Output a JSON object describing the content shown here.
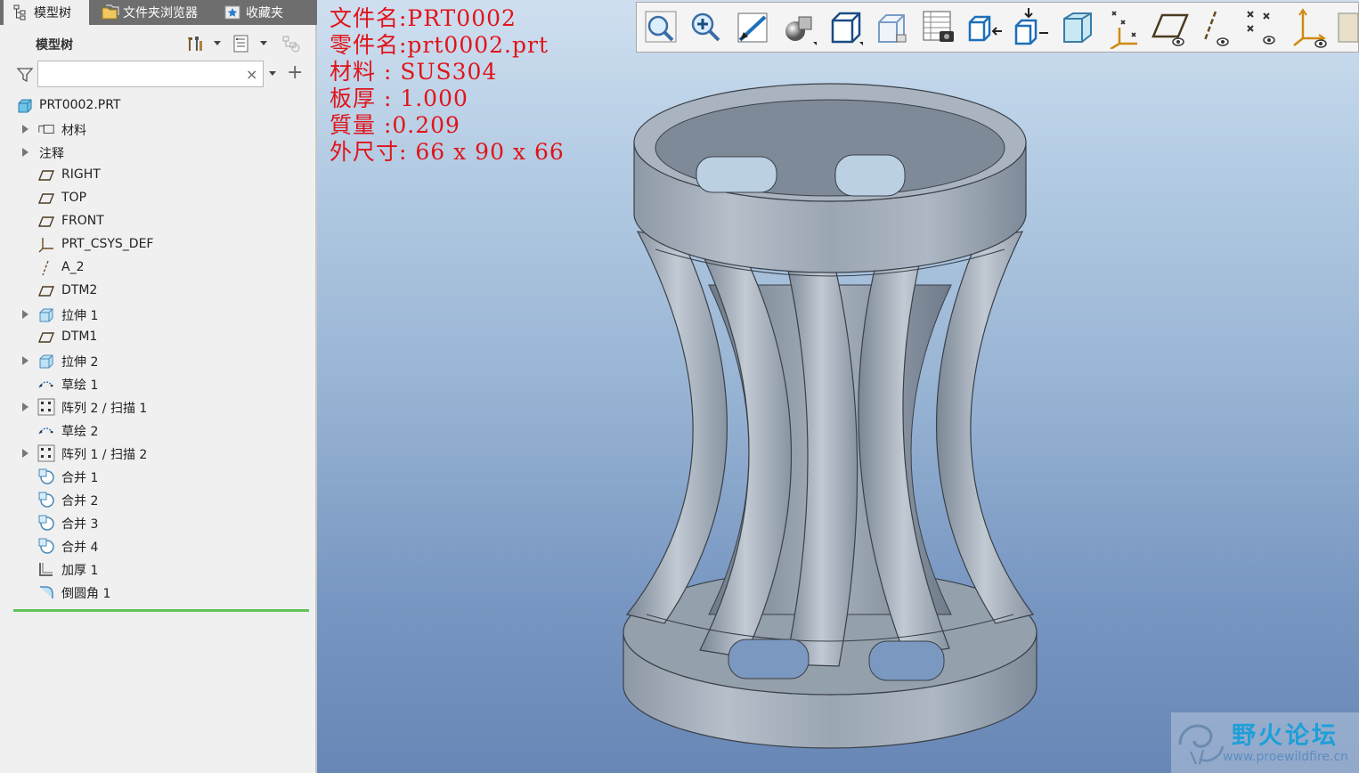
{
  "tabs": [
    {
      "label": "模型树",
      "icon": "model-tree-icon"
    },
    {
      "label": "文件夹浏览器",
      "icon": "folder-browser-icon"
    },
    {
      "label": "收藏夹",
      "icon": "favorites-icon"
    }
  ],
  "tree_header": {
    "label": "模型树"
  },
  "search": {
    "value": "",
    "placeholder": "",
    "clear_glyph": "×"
  },
  "add_glyph": "+",
  "tree": {
    "items": [
      {
        "label": "PRT0002.PRT",
        "icon": "part-icon",
        "expandable": false
      },
      {
        "label": "材料",
        "icon": "material-icon",
        "expandable": true
      },
      {
        "label": "注释",
        "icon": "",
        "expandable": true
      },
      {
        "label": "RIGHT",
        "icon": "datum-plane-icon",
        "expandable": false
      },
      {
        "label": "TOP",
        "icon": "datum-plane-icon",
        "expandable": false
      },
      {
        "label": "FRONT",
        "icon": "datum-plane-icon",
        "expandable": false
      },
      {
        "label": "PRT_CSYS_DEF",
        "icon": "csys-icon",
        "expandable": false
      },
      {
        "label": "A_2",
        "icon": "datum-axis-icon",
        "expandable": false
      },
      {
        "label": "DTM2",
        "icon": "datum-plane-icon",
        "expandable": false
      },
      {
        "label": "拉伸 1",
        "icon": "extrude-icon",
        "expandable": true
      },
      {
        "label": "DTM1",
        "icon": "datum-plane-icon",
        "expandable": false
      },
      {
        "label": "拉伸 2",
        "icon": "extrude-icon",
        "expandable": true
      },
      {
        "label": "草绘 1",
        "icon": "sketch-icon",
        "expandable": false
      },
      {
        "label": "阵列 2 / 扫描 1",
        "icon": "pattern-icon",
        "expandable": true
      },
      {
        "label": "草绘 2",
        "icon": "sketch-icon",
        "expandable": false
      },
      {
        "label": "阵列 1 / 扫描 2",
        "icon": "pattern-icon",
        "expandable": true
      },
      {
        "label": "合并 1",
        "icon": "merge-icon",
        "expandable": false
      },
      {
        "label": "合并 2",
        "icon": "merge-icon",
        "expandable": false
      },
      {
        "label": "合并 3",
        "icon": "merge-icon",
        "expandable": false
      },
      {
        "label": "合并 4",
        "icon": "merge-icon",
        "expandable": false
      },
      {
        "label": "加厚 1",
        "icon": "thicken-icon",
        "expandable": false
      },
      {
        "label": "倒圆角 1",
        "icon": "round-icon",
        "expandable": false
      }
    ]
  },
  "info": {
    "lines": [
      "文件名:PRT0002",
      "零件名:prt0002.prt",
      "材料 : SUS304",
      "板厚 : 1.000",
      "質量 :0.209",
      "外尺寸: 66 x 90 x 66"
    ],
    "color": "#e0141a"
  },
  "toolbar": {
    "buttons": [
      "refit-icon",
      "zoom-in-icon",
      "repaint-icon",
      "shading-icon",
      "named-views-icon",
      "saved-orientations-icon",
      "view-manager-icon",
      "extrude-view-icon",
      "insert-view-icon",
      "perspective-icon",
      "datum-display-icon",
      "plane-display-icon",
      "axis-display-icon",
      "point-display-icon",
      "csys-display-icon",
      "more-icon"
    ]
  },
  "watermark": {
    "title": "野火论坛",
    "url": "www.proewildfire.cn"
  },
  "colors": {
    "viewport_top": "#cfdff0",
    "viewport_bottom": "#6887b6",
    "model": "#9aa6b4",
    "active_green": "#5ec65a"
  }
}
